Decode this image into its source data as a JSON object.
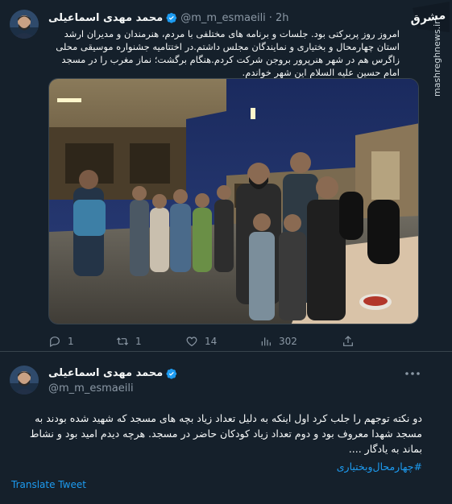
{
  "tweet1": {
    "display_name": "محمد مهدی اسماعیلی",
    "handle": "@m_m_esmaeili",
    "dot": "·",
    "time": "2h",
    "text": "امروز روز پربرکتی بود. جلسات و برنامه های مختلفی با مردم، هنرمندان و مدیران ارشد استان چهارمحال و بختیاری و نمایندگان مجلس داشتم.در اختتامیه جشنواره موسیقی محلی زاگرس هم در شهر هنرپرور بروجن شرکت کردم.هنگام برگشت؛ نماز مغرب را در مسجد امام حسین علیه السلام این شهر خواندم.",
    "actions": {
      "reply_count": "1",
      "retweet_count": "1",
      "like_count": "14",
      "views_count": "302"
    }
  },
  "watermark": {
    "logo_text": "مشرق",
    "site": "mashreghnews.ir"
  },
  "tweet2": {
    "display_name": "محمد مهدی اسماعیلی",
    "handle": "@m_m_esmaeili",
    "text": "دو نکته توجهم را جلب کرد اول اینکه به دلیل تعداد زیاد بچه های مسجد که شهید شده بودند به مسجد شهدا معروف بود و دوم تعداد زیاد کودکان حاضر در مسجد. هرچه دیدم امید بود و نشاط بماند به یادگار ....",
    "hashtag": "#چهارمحال‌وبختیاری",
    "translate_label": "Translate Tweet"
  },
  "icons": [
    "verified-badge-icon",
    "reply-icon",
    "retweet-icon",
    "like-icon",
    "views-icon",
    "share-icon",
    "more-icon"
  ],
  "colors": {
    "background": "#15202b",
    "text": "#f7f9f9",
    "muted": "#8b98a5",
    "accent": "#1d9bf0",
    "divider": "#38444d"
  }
}
